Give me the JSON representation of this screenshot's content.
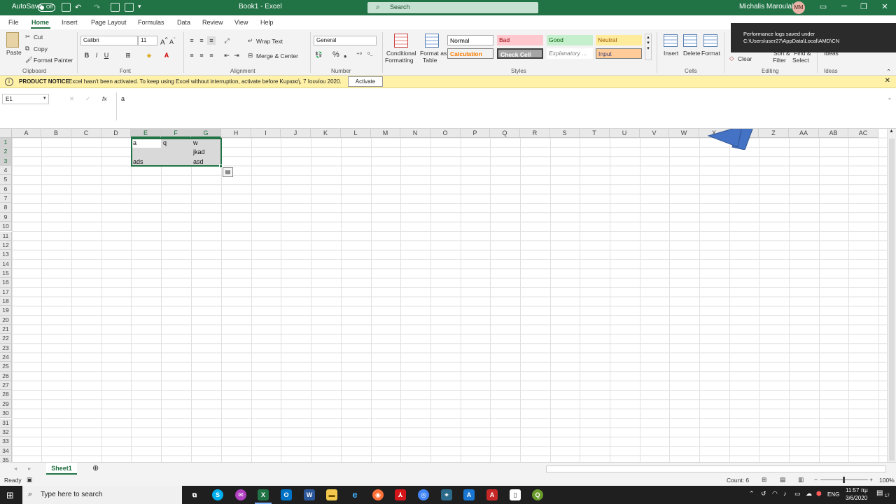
{
  "titlebar": {
    "autosave_label": "AutoSave",
    "autosave_state": "Off",
    "doc_title": "Book1 - Excel",
    "search_placeholder": "Search",
    "user_name": "Michalis Maroulakis",
    "user_initials": "MM",
    "accent": "#217346"
  },
  "tabs": [
    "File",
    "Home",
    "Insert",
    "Page Layout",
    "Formulas",
    "Data",
    "Review",
    "View",
    "Help"
  ],
  "ribbon": {
    "clipboard": {
      "paste": "Paste",
      "cut": "Cut",
      "copy": "Copy",
      "format_painter": "Format Painter",
      "group": "Clipboard"
    },
    "font": {
      "name": "Calibri",
      "size": "11",
      "group": "Font"
    },
    "alignment": {
      "wrap_text": "Wrap Text",
      "merge_center": "Merge & Center",
      "group": "Alignment"
    },
    "number": {
      "format": "General",
      "group": "Number"
    },
    "styles": {
      "conditional_1": "Conditional",
      "conditional_2": "Formatting",
      "format_table_1": "Format as",
      "format_table_2": "Table",
      "normal": "Normal",
      "bad": "Bad",
      "good": "Good",
      "neutral": "Neutral",
      "calculation": "Calculation",
      "check_cell": "Check Cell",
      "explanatory": "Explanatory ...",
      "input": "Input",
      "group": "Styles"
    },
    "cells": {
      "insert": "Insert",
      "delete": "Delete",
      "format": "Format",
      "group": "Cells"
    },
    "editing": {
      "clear": "Clear",
      "sort_filter_1": "Sort &",
      "sort_filter_2": "Filter",
      "find_select_1": "Find &",
      "find_select_2": "Select",
      "group": "Editing"
    },
    "ideas": {
      "label": "Ideas",
      "group": "Ideas"
    }
  },
  "toast": {
    "line1": "Performance logs saved under",
    "line2": "C:\\Users\\user27\\AppData\\Local\\AMD\\CN"
  },
  "notice": {
    "title": "PRODUCT NOTICE",
    "message": "Excel hasn't been activated. To keep using Excel without interruption, activate before Κυριακή, 7 Ιουνίου 2020.",
    "button": "Activate"
  },
  "formula_bar": {
    "name_box": "E1",
    "fx": "fx",
    "content": "a"
  },
  "grid": {
    "columns": [
      "A",
      "B",
      "C",
      "D",
      "E",
      "F",
      "G",
      "H",
      "I",
      "J",
      "K",
      "L",
      "M",
      "N",
      "O",
      "P",
      "Q",
      "R",
      "S",
      "T",
      "U",
      "V",
      "W",
      "X",
      "Y",
      "Z",
      "AA",
      "AB",
      "AC"
    ],
    "rows": [
      "1",
      "2",
      "3",
      "4",
      "5",
      "6",
      "7",
      "8",
      "9",
      "10",
      "11",
      "12",
      "13",
      "14",
      "15",
      "16",
      "17",
      "18",
      "19",
      "20",
      "21",
      "22",
      "23",
      "24",
      "25",
      "26",
      "27",
      "28",
      "29",
      "30",
      "31",
      "32",
      "33",
      "34",
      "35"
    ],
    "cells": [
      {
        "ref": "E1",
        "value": "a"
      },
      {
        "ref": "F1",
        "value": "q"
      },
      {
        "ref": "G1",
        "value": "w"
      },
      {
        "ref": "G2",
        "value": "jkad"
      },
      {
        "ref": "E3",
        "value": "ads"
      },
      {
        "ref": "G3",
        "value": "asd"
      }
    ],
    "selected_range": "E1:G3"
  },
  "sheets": {
    "active": "Sheet1"
  },
  "status": {
    "mode": "Ready",
    "count": "Count: 6",
    "zoom": "100%"
  },
  "taskbar": {
    "search_placeholder": "Type here to search",
    "language": "ENG",
    "time": "11:57 πμ",
    "date": "3/6/2020",
    "notifications": "17"
  }
}
